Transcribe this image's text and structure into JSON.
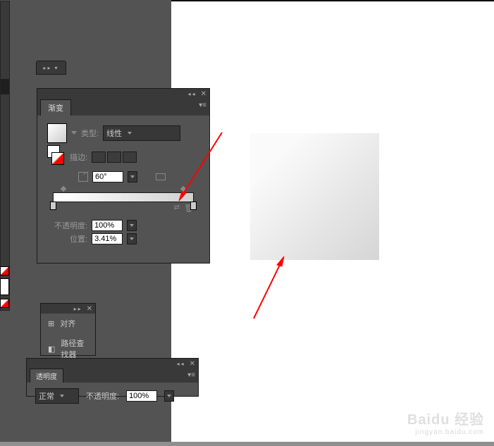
{
  "gradientPanel": {
    "tab": "渐变",
    "type_label": "类型:",
    "type_value": "线性",
    "stroke_label": "描边:",
    "angle_value": "60°",
    "opacity_label": "不透明度:",
    "opacity_value": "100%",
    "position_label": "位置:",
    "position_value": "3.41%"
  },
  "alignPanel": {
    "item1": "对齐",
    "item2": "路径查找器"
  },
  "transparencyPanel": {
    "tab": "透明度",
    "mode": "正常",
    "opacity_label": "不透明度:",
    "opacity_value": "100%"
  },
  "watermark": {
    "brand": "Baidu 经验",
    "url": "jingyan.baidu.com"
  }
}
